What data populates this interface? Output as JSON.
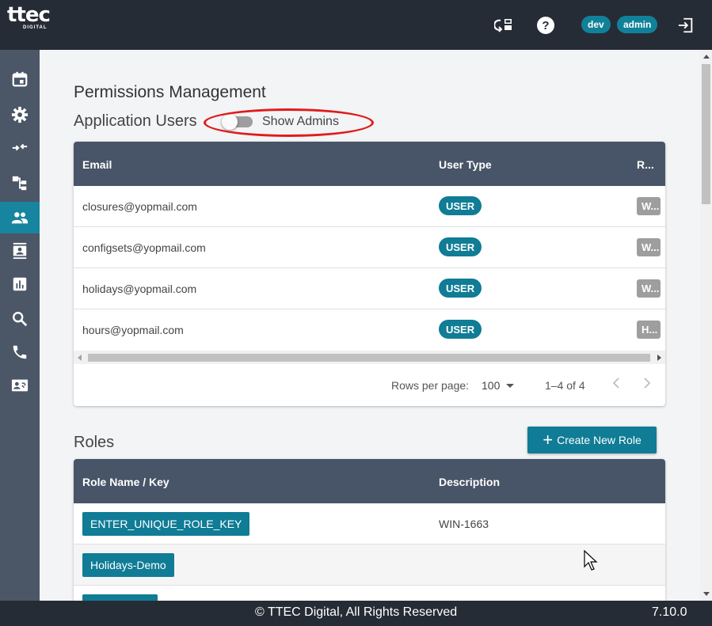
{
  "header": {
    "logo_text": "ttec",
    "logo_sub": "DIGITAL",
    "icons": [
      "chat-switch-icon",
      "help-icon",
      "logout-icon"
    ],
    "env_badge": "dev",
    "user_badge": "admin"
  },
  "sidebar": {
    "items": [
      {
        "icon": "calendar-icon"
      },
      {
        "icon": "gear-icon"
      },
      {
        "icon": "merge-arrows-icon"
      },
      {
        "icon": "hierarchy-icon"
      },
      {
        "icon": "users-icon",
        "active": true
      },
      {
        "icon": "contact-card-icon"
      },
      {
        "icon": "bar-chart-icon"
      },
      {
        "icon": "search-icon"
      },
      {
        "icon": "phone-icon"
      },
      {
        "icon": "id-card-icon"
      }
    ]
  },
  "page": {
    "title": "Permissions Management",
    "users_section_title": "Application Users",
    "show_admins_label": "Show Admins",
    "show_admins_on": false
  },
  "users_table": {
    "columns": [
      "Email",
      "User Type",
      "R..."
    ],
    "rows": [
      {
        "email": "closures@yopmail.com",
        "type": "USER",
        "role": "W..."
      },
      {
        "email": "configsets@yopmail.com",
        "type": "USER",
        "role": "W..."
      },
      {
        "email": "holidays@yopmail.com",
        "type": "USER",
        "role": "W..."
      },
      {
        "email": "hours@yopmail.com",
        "type": "USER",
        "role": "H..."
      }
    ],
    "pagination": {
      "rows_per_page_label": "Rows per page:",
      "rows_per_page_value": "100",
      "range": "1–4 of 4"
    }
  },
  "roles": {
    "title": "Roles",
    "create_label": "Create New Role",
    "columns": [
      "Role Name / Key",
      "Description"
    ],
    "rows": [
      {
        "key": "ENTER_UNIQUE_ROLE_KEY",
        "description": "WIN-1663"
      },
      {
        "key": "Holidays-Demo",
        "description": ""
      }
    ]
  },
  "footer": {
    "copyright": "© TTEC Digital, All Rights Reserved",
    "version": "7.10.0"
  },
  "colors": {
    "header_bg": "#262c36",
    "sidebar_bg": "#4b5667",
    "accent": "#107c96",
    "table_header": "#485568",
    "annotation": "#e01b1b"
  }
}
